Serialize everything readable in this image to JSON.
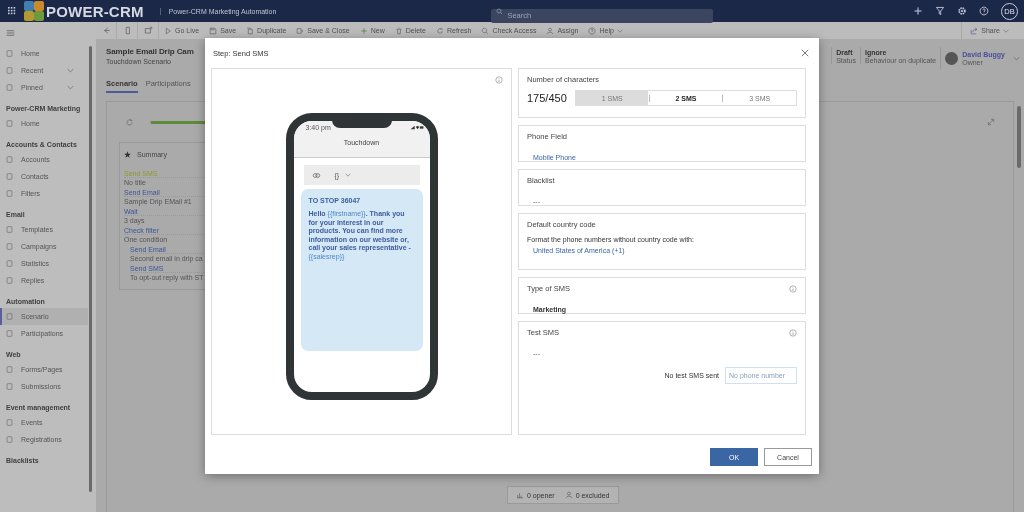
{
  "topbar": {
    "logo": "POWER-CRM",
    "app_title": "Power-CRM Marketing Automation",
    "search": {
      "placeholder": "Search"
    },
    "avatar": "DB"
  },
  "sidebar": {
    "groups": [
      {
        "items": [
          {
            "label": "Home",
            "selected": false
          },
          {
            "label": "Recent",
            "selected": false,
            "expanded": false
          },
          {
            "label": "Pinned",
            "selected": false,
            "expanded": false
          }
        ]
      },
      {
        "heading": "Power-CRM Marketing",
        "items": [
          {
            "label": "Home",
            "selected": false
          }
        ]
      },
      {
        "heading": "Accounts & Contacts",
        "items": [
          {
            "label": "Accounts",
            "selected": false
          },
          {
            "label": "Contacts",
            "selected": false
          },
          {
            "label": "Filters",
            "selected": false
          }
        ]
      },
      {
        "heading": "Email",
        "items": [
          {
            "label": "Templates",
            "selected": false
          },
          {
            "label": "Campaigns",
            "selected": false
          },
          {
            "label": "Statistics",
            "selected": false
          },
          {
            "label": "Replies",
            "selected": false
          }
        ]
      },
      {
        "heading": "Automation",
        "items": [
          {
            "label": "Scenario",
            "selected": true
          },
          {
            "label": "Participations",
            "selected": false
          }
        ]
      },
      {
        "heading": "Web",
        "items": [
          {
            "label": "Forms/Pages",
            "selected": false
          },
          {
            "label": "Submissions",
            "selected": false
          }
        ]
      },
      {
        "heading": "Event management",
        "items": [
          {
            "label": "Events",
            "selected": false
          },
          {
            "label": "Registrations",
            "selected": false
          }
        ]
      },
      {
        "heading": "Blacklists"
      }
    ]
  },
  "command_bar": {
    "items": [
      {
        "kind": "icon"
      },
      {
        "kind": "icon"
      },
      {
        "kind": "icon"
      },
      {
        "kind": "button",
        "label": "Go Live"
      },
      {
        "kind": "button",
        "label": "Save"
      },
      {
        "kind": "button",
        "label": "Duplicate"
      },
      {
        "kind": "button",
        "label": "Save & Close"
      },
      {
        "kind": "button",
        "label": "New"
      },
      {
        "kind": "button",
        "label": "Delete"
      },
      {
        "kind": "button",
        "label": "Refresh"
      },
      {
        "kind": "button",
        "label": "Check Access"
      },
      {
        "kind": "button",
        "label": "Assign"
      },
      {
        "kind": "menu",
        "label": "Help"
      }
    ],
    "share": "Share"
  },
  "record": {
    "title": "Sample Email Drip Cam",
    "subtitle": "Touchdown Scenario",
    "tabs": [
      {
        "label": "Scenario",
        "selected": true
      },
      {
        "label": "Participations",
        "selected": false
      }
    ],
    "fields": [
      {
        "value": "Draft",
        "label": "Status"
      },
      {
        "value": "Ignore",
        "label": "Behaviour on duplicate"
      }
    ],
    "owner": {
      "name": "David Buggy",
      "label": "Owner"
    }
  },
  "summary": {
    "title": "Summary",
    "steps": [
      {
        "name": "Send SMS",
        "detail": "No title",
        "active": true
      },
      {
        "name": "Send Email",
        "detail": "Sample Drip EMail #1",
        "active": false
      },
      {
        "name": "Wait",
        "detail": "3 days",
        "active": false
      },
      {
        "name": "Check filter",
        "detail": "One condition",
        "active": false,
        "children": [
          {
            "name": "Send Email",
            "detail": "Second email in drip ca",
            "active": false
          },
          {
            "name": "Send SMS",
            "detail": "To opt-out reply with ST",
            "active": false
          }
        ]
      }
    ]
  },
  "stats": [
    {
      "label": "0 opener"
    },
    {
      "label": "0 excluded"
    }
  ],
  "modal": {
    "title": "Step: Send SMS",
    "phone": {
      "time": "3:40 pm",
      "contact": "Touchdown",
      "token_button": "{}",
      "stop_line": "TO STOP 36047",
      "message": [
        {
          "kind": "text",
          "text": "Hello "
        },
        {
          "kind": "tag",
          "text": "{{firstname}}"
        },
        {
          "kind": "text",
          "text": ". Thank you for your interest in our products. You can find more information on our website or, call your sales representative - "
        },
        {
          "kind": "tag",
          "text": "{{salesrep}}"
        }
      ]
    },
    "cards": [
      {
        "kind": "counter",
        "title": "Number of characters",
        "info": false,
        "count": "175/450",
        "level": 0.33,
        "segments": [
          {
            "label": "1 SMS",
            "selected": false
          },
          {
            "label": "2 SMS",
            "selected": true
          },
          {
            "label": "3 SMS",
            "selected": false
          }
        ]
      },
      {
        "kind": "link",
        "title": "Phone Field",
        "info": false,
        "value": "Mobile Phone"
      },
      {
        "kind": "empty",
        "title": "Blacklist",
        "info": false,
        "value": "---"
      },
      {
        "kind": "country",
        "title": "Default country code",
        "info": false,
        "hint": "Format the phone numbers without country code with:",
        "value": "United States of America (+1)"
      },
      {
        "kind": "strong",
        "title": "Type of SMS",
        "info": true,
        "value": "Marketing"
      },
      {
        "kind": "test",
        "title": "Test SMS",
        "info": true,
        "value": "---",
        "status": "No test SMS sent",
        "input": {
          "placeholder": "No phone number"
        }
      }
    ],
    "buttons": [
      {
        "kind": "primary",
        "label": "OK"
      },
      {
        "kind": "secondary",
        "label": "Cancel"
      }
    ]
  }
}
